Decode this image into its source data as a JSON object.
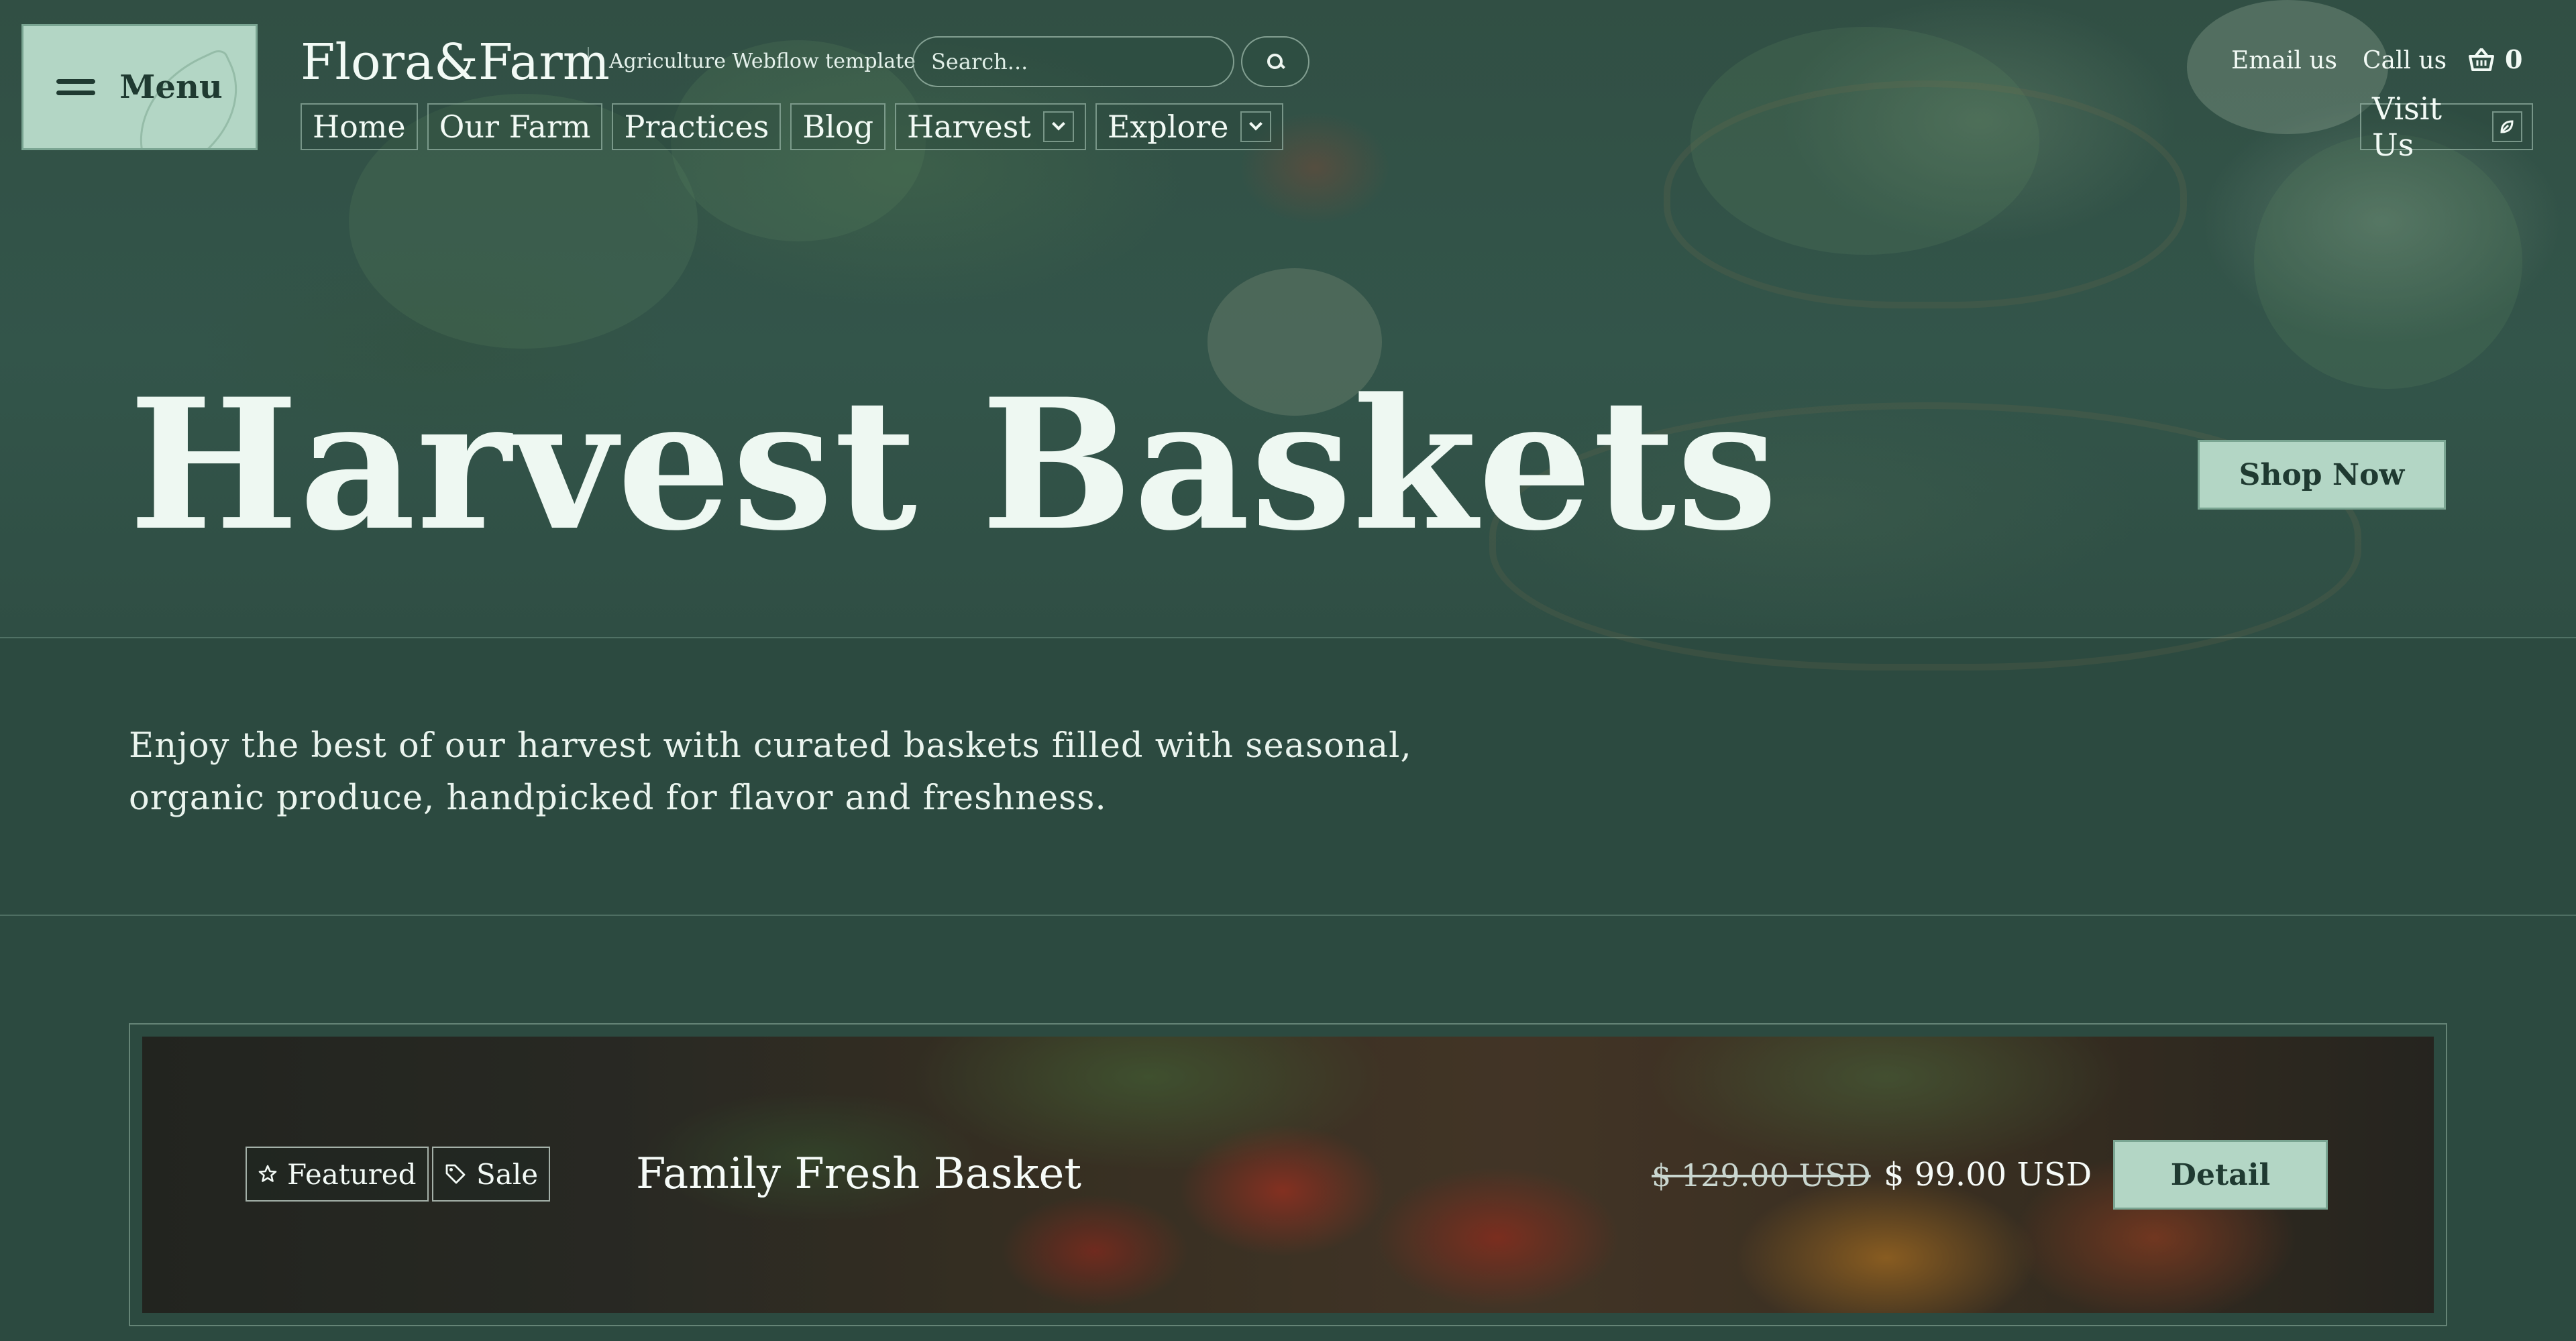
{
  "menu": {
    "label": "Menu",
    "icon": "hamburger-icon"
  },
  "brand": {
    "logo": "Flora&Farm",
    "tagline": "Agriculture Webflow template"
  },
  "search": {
    "placeholder": "Search...",
    "icon": "search-icon"
  },
  "nav": {
    "items": [
      {
        "label": "Home"
      },
      {
        "label": "Our Farm"
      },
      {
        "label": "Practices"
      },
      {
        "label": "Blog"
      },
      {
        "label": "Harvest",
        "dropdown": true
      },
      {
        "label": "Explore",
        "dropdown": true
      }
    ]
  },
  "top_links": {
    "email": "Email us",
    "call": "Call us"
  },
  "cart": {
    "count": "0",
    "icon": "basket-icon"
  },
  "visit": {
    "label": "Visit Us",
    "icon": "leaf-icon"
  },
  "hero": {
    "title": "Harvest Baskets",
    "cta": "Shop Now"
  },
  "intro": {
    "text": "Enjoy the best of our harvest with curated baskets filled with seasonal, organic produce, handpicked for flavor and freshness."
  },
  "product": {
    "tags": [
      {
        "label": "Featured",
        "icon": "star-icon"
      },
      {
        "label": "Sale",
        "icon": "tag-icon"
      }
    ],
    "name": "Family Fresh Basket",
    "old_price": "$ 129.00 USD",
    "price": "$ 99.00 USD",
    "cta": "Detail"
  },
  "colors": {
    "background": "#2c4a40",
    "button": "#b3d6c5",
    "button_text": "#1f3a31",
    "text": "#eef6f1"
  }
}
